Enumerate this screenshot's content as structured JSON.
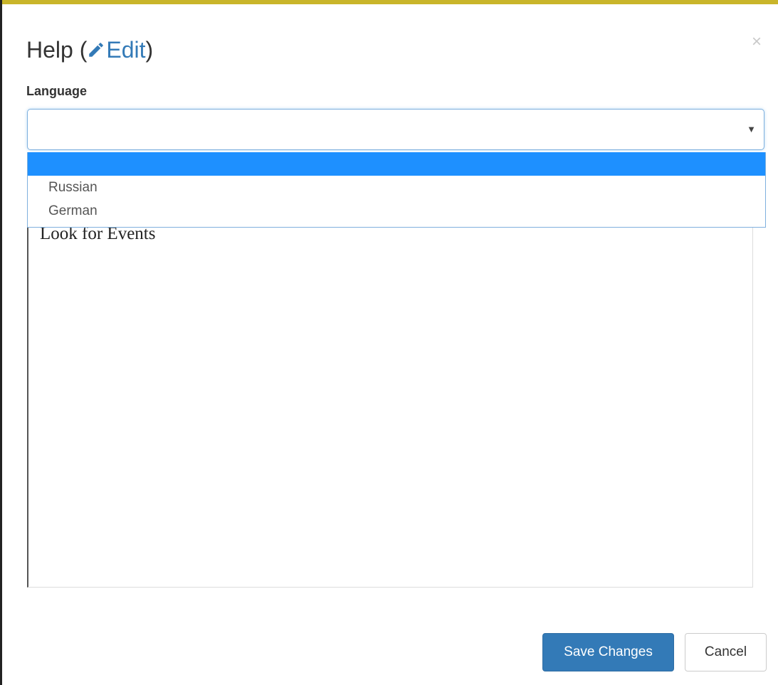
{
  "modal": {
    "title_prefix": "Help (",
    "edit_label": "Edit",
    "title_suffix": ")",
    "close_glyph": "×",
    "accent_color": "#c9b52a"
  },
  "language": {
    "label": "Language",
    "selected_value": "",
    "caret_glyph": "▼",
    "options": [
      {
        "label": "",
        "highlighted": true
      },
      {
        "label": "Russian",
        "highlighted": false
      },
      {
        "label": "German",
        "highlighted": false
      }
    ],
    "highlight_color": "#1e90ff"
  },
  "editor": {
    "content": "Look for Events"
  },
  "footer": {
    "save_label": "Save Changes",
    "cancel_label": "Cancel",
    "primary_color": "#337ab7"
  },
  "icons": {
    "edit": "pencil-icon",
    "close": "close-icon",
    "dropdown": "caret-down-icon"
  }
}
